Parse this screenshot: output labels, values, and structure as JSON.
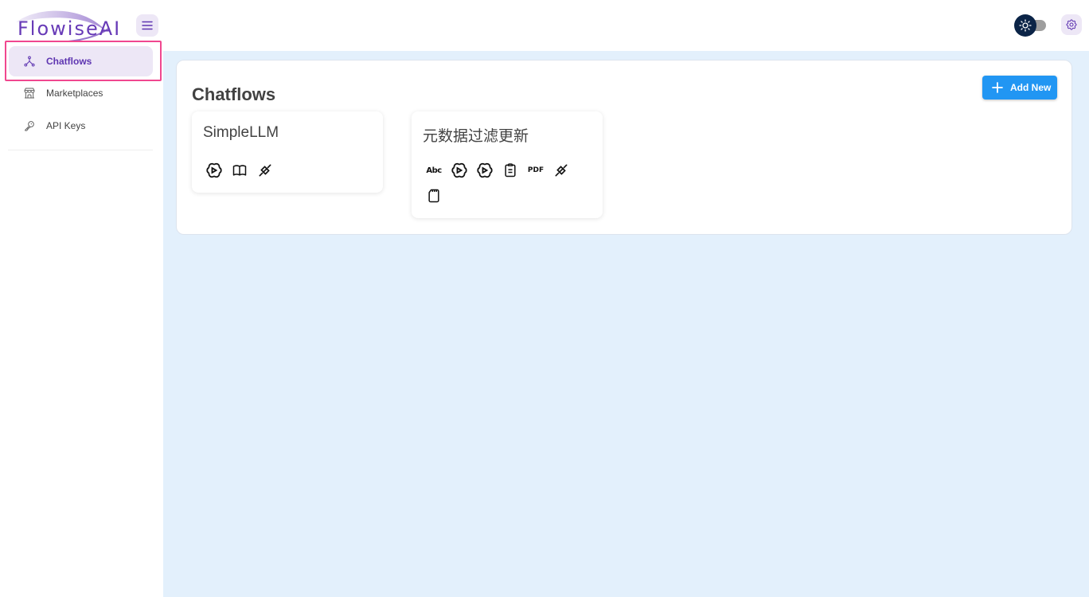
{
  "app": {
    "logo_text": "FlowiseAI"
  },
  "sidebar": {
    "items": [
      {
        "label": "Chatflows",
        "icon": "hierarchy-icon",
        "active": true
      },
      {
        "label": "Marketplaces",
        "icon": "building-store-icon",
        "active": false
      },
      {
        "label": "API Keys",
        "icon": "key-icon",
        "active": false
      }
    ]
  },
  "main": {
    "title": "Chatflows",
    "add_button_label": "Add New",
    "cards": [
      {
        "title": "SimpleLLM",
        "icons": [
          "openai-icon",
          "book-icon",
          "chain-icon"
        ]
      },
      {
        "title": "元数据过滤更新",
        "icons": [
          "abc-icon",
          "openai-icon",
          "openai-icon",
          "clipboard-icon",
          "pdf-icon",
          "chain-icon",
          "memory-card-icon"
        ]
      }
    ],
    "icon_text": {
      "abc": "Abc",
      "pdf": "PDF"
    }
  },
  "colors": {
    "accent": "#673ab7",
    "active_bg": "#ede7f6",
    "primary_button": "#2196f3",
    "main_bg": "#e3f0fc",
    "highlight": "#f0478f",
    "toggle_thumb": "#0b2447"
  }
}
